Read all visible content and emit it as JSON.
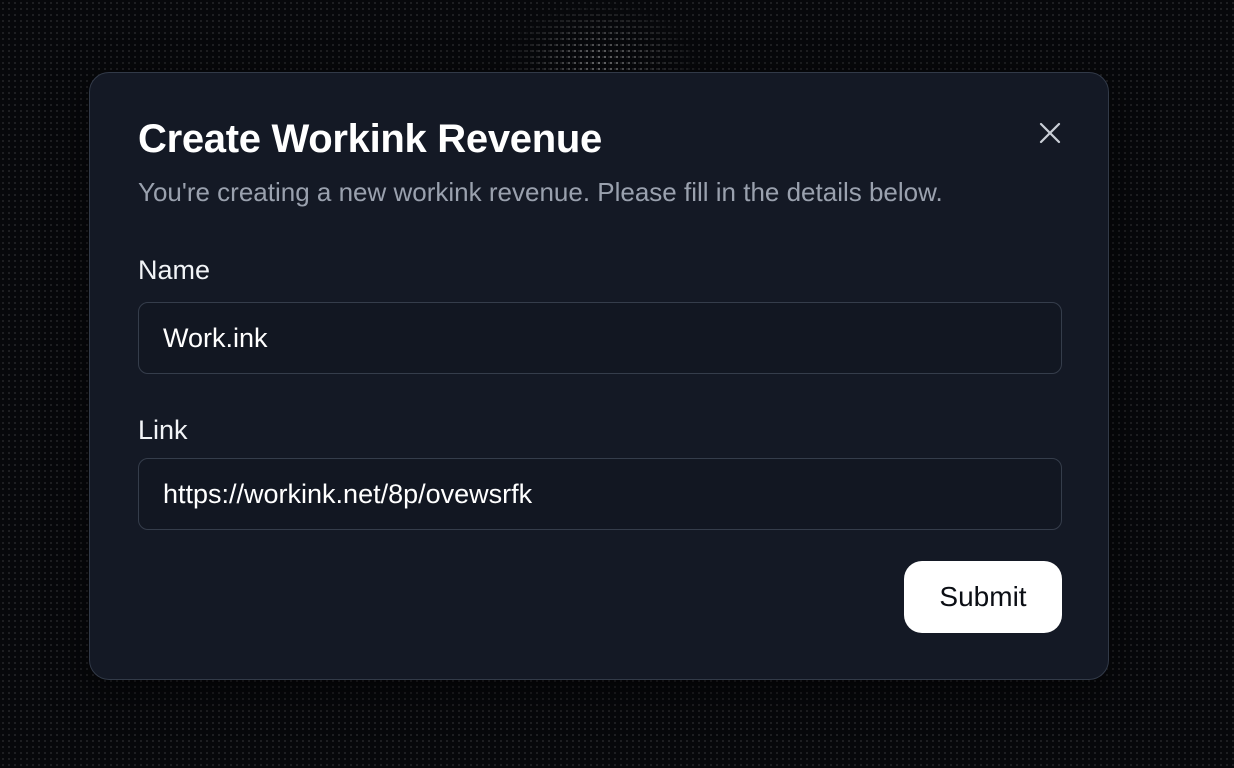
{
  "dialog": {
    "title": "Create Workink Revenue",
    "subtitle": "You're creating a new workink revenue. Please fill in the details below.",
    "close_icon": "close-icon"
  },
  "form": {
    "name": {
      "label": "Name",
      "value": "Work.ink"
    },
    "link": {
      "label": "Link",
      "value": "https://workink.net/8p/ovewsrfk"
    },
    "submit_label": "Submit"
  },
  "colors": {
    "background": "#07080b",
    "dialog_bg": "#141925",
    "border": "#323a48",
    "muted_text": "#9aa1ae",
    "button_bg": "#ffffff"
  }
}
